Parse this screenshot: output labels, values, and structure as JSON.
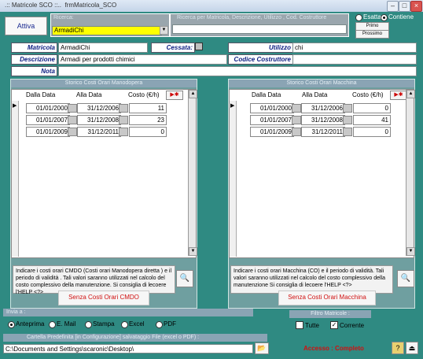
{
  "window": {
    "title": ".:: Matricole SCO ::..  frmMatricola_SCO"
  },
  "top": {
    "attiva_label": "Attiva",
    "ricerca_caption": "Ricerca:",
    "ricerca_value": "ArmadiChi",
    "search_caption": "Ricerca per Matricola, Descrizione, Utilizzo , Cod. Costruttore",
    "search_value": "",
    "esatta_label": "Esatta",
    "contiene_label": "Contiene",
    "primo_label": "Primo",
    "prossimo_label": "Prossimo"
  },
  "form": {
    "matricola_label": "Matricola",
    "matricola_value": "ArmadiChi",
    "cessata_label": "Cessata:",
    "utilizzo_label": "Utilizzo",
    "utilizzo_value": "chi",
    "descrizione_label": "Descrizione",
    "descrizione_value": "Armadi per prodotti chimici",
    "codice_label": "Codice Costruttore",
    "codice_value": "",
    "nota_label": "Nota",
    "nota_value": ""
  },
  "manodopera": {
    "title": "Storico Costi Orari Manodopera",
    "col_dalla": "Dalla Data",
    "col_alla": "Alla Data",
    "col_costo": "Costo (€/h)",
    "rows": [
      {
        "dalla": "01/01/2000",
        "alla": "31/12/2006",
        "costo": "11"
      },
      {
        "dalla": "01/01/2007",
        "alla": "31/12/2008",
        "costo": "23"
      },
      {
        "dalla": "01/01/2009",
        "alla": "31/12/2011",
        "costo": "0"
      }
    ],
    "info": "Indicare i costi orari CMDO (Costi orari Manodopera diretta ) e il periodo di validità . Tali valori saranno utilizzati nel calcolo del costo complessivo della manutenzione.  Si consiglia di lecoere l'HELP <?>",
    "senza_label": "Senza Costi Orari CMDO"
  },
  "macchina": {
    "title": "Storico Costi Orari Macchina",
    "col_dalla": "Dalla Data",
    "col_alla": "Alla Data",
    "col_costo": "Costo (€/h)",
    "rows": [
      {
        "dalla": "01/01/2000",
        "alla": "31/12/2006",
        "costo": "0"
      },
      {
        "dalla": "01/01/2007",
        "alla": "31/12/2008",
        "costo": "41"
      },
      {
        "dalla": "01/01/2009",
        "alla": "31/12/2011",
        "costo": "0"
      }
    ],
    "info": "Indicare i costi orari Macchina (CO) e il periodo di validità. Tali  valori saranno utilizzati nel calcolo del costo complessivo della manutenzione Si consiglia di lecoere l'HELP <?>",
    "senza_label": "Senza Costi Orari Macchina"
  },
  "invia": {
    "title": "Invia a :",
    "anteprima": "Anteprima",
    "email": "E. Mail",
    "stampa": "Stampa",
    "excel": "Excel",
    "pdf": "PDF"
  },
  "filtro": {
    "title": "Filtro Matricole :",
    "tutte": "Tutte",
    "corrente": "Corrente"
  },
  "cartella": {
    "title": "Cartella Predefinita  [in Configurazione] salvataggio File (excel o PDF) :",
    "path": "C:\\Documents and Settings\\scaronic\\Desktop\\"
  },
  "status": {
    "accesso": "Accesso : Completo"
  },
  "colors": {
    "teal": "#2f8a82",
    "label_blue": "#0a1a80",
    "status_red": "#d01010",
    "yellow": "#ffff00"
  }
}
